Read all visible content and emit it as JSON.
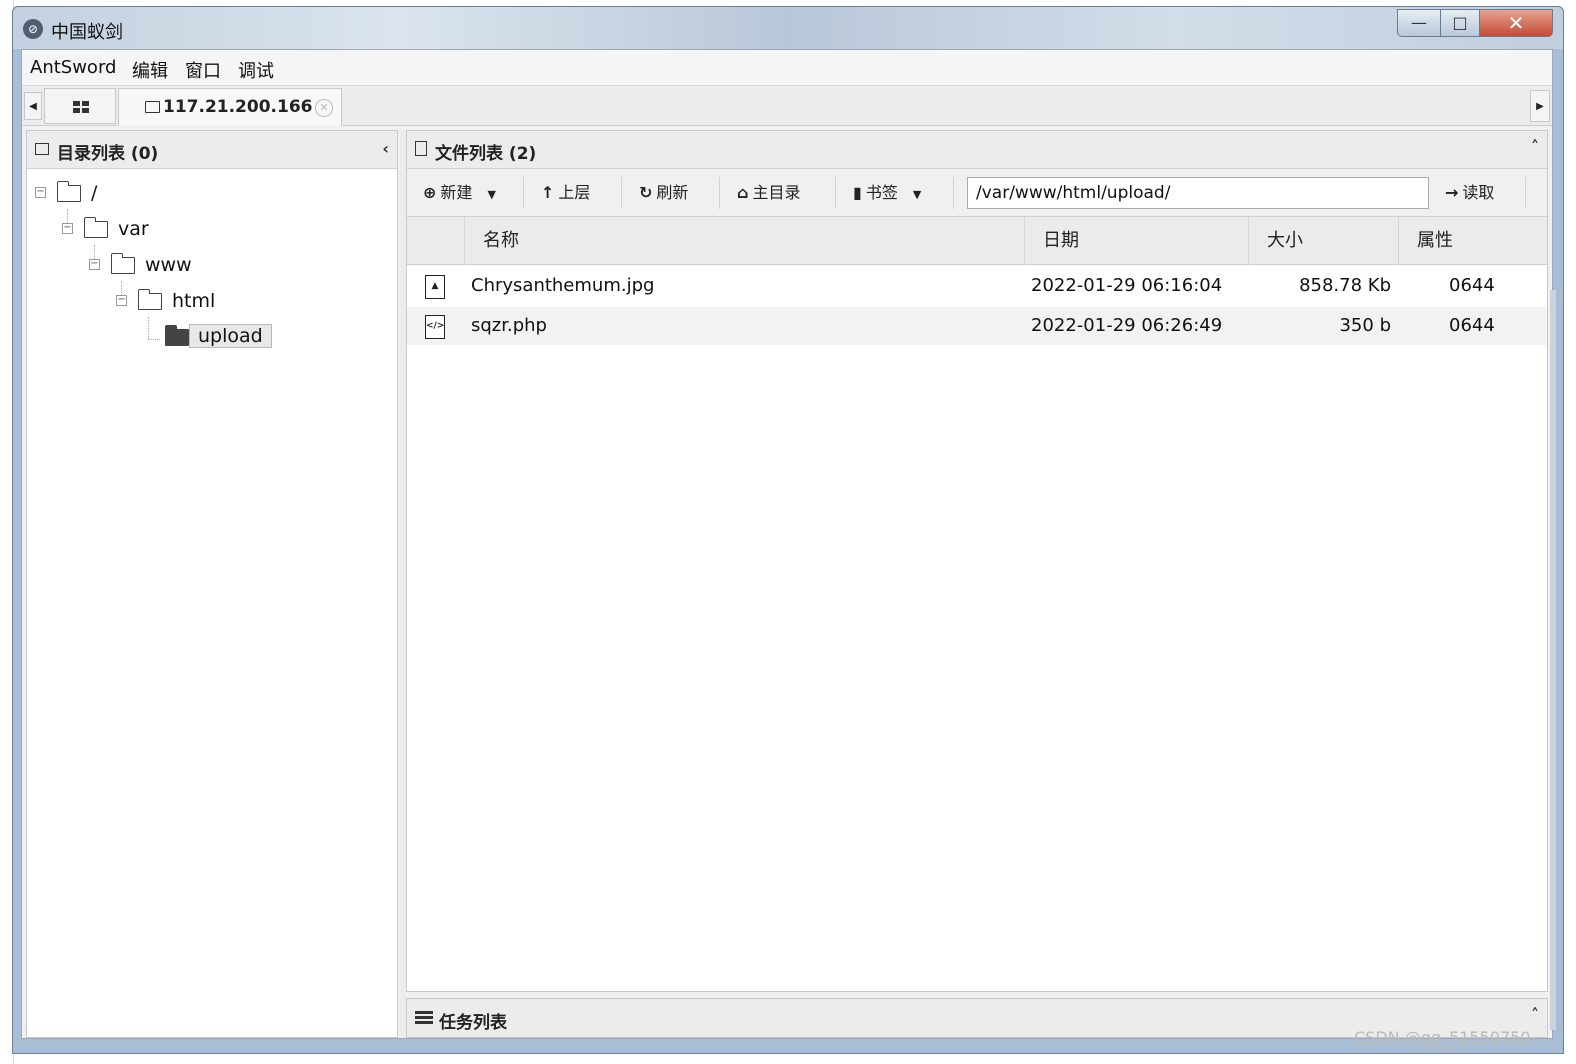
{
  "window": {
    "title": "中国蚁剑",
    "min_symbol": "—",
    "max_symbol": "□",
    "close_symbol": "✕"
  },
  "menu": [
    "AntSword",
    "编辑",
    "窗口",
    "调试"
  ],
  "tabs": {
    "main_label": "117.21.200.166",
    "close_symbol": "✕",
    "left_arrow": "◀",
    "right_arrow": "▶"
  },
  "dir_panel": {
    "title": "目录列表 (0)",
    "collapse_symbol": "‹",
    "tree": [
      {
        "label": "/",
        "expander": "−"
      },
      {
        "label": "var",
        "expander": "−"
      },
      {
        "label": "www",
        "expander": "−"
      },
      {
        "label": "html",
        "expander": "−"
      },
      {
        "label": "upload",
        "selected": true
      }
    ]
  },
  "file_panel": {
    "title": "文件列表 (2)",
    "collapse_symbol": "˄",
    "toolbar": {
      "new_label": "新建",
      "new_icon": "⊕",
      "up_label": "上层",
      "up_icon": "↑",
      "refresh_label": "刷新",
      "refresh_icon": "↻",
      "home_label": "主目录",
      "home_icon": "⌂",
      "bookmark_label": "书签",
      "bookmark_icon": "▮",
      "dropdown_symbol": "▼",
      "path_value": "/var/www/html/upload/",
      "read_label": "读取",
      "read_icon": "→"
    },
    "columns": {
      "name": "名称",
      "date": "日期",
      "size": "大小",
      "attr": "属性"
    },
    "rows": [
      {
        "name": "Chrysanthemum.jpg",
        "date": "2022-01-29 06:16:04",
        "size": "858.78 Kb",
        "attr": "0644",
        "icon": "image-file-icon",
        "icon_glyph": "▲"
      },
      {
        "name": "sqzr.php",
        "date": "2022-01-29 06:26:49",
        "size": "350 b",
        "attr": "0644",
        "icon": "code-file-icon",
        "icon_glyph": "</>"
      }
    ]
  },
  "task_panel": {
    "title": "任务列表",
    "collapse_symbol": "˄"
  },
  "watermark": "CSDN @qq_51550750",
  "colors": {
    "close_button": "#c44b32",
    "titlebar": "#c3d0df"
  }
}
